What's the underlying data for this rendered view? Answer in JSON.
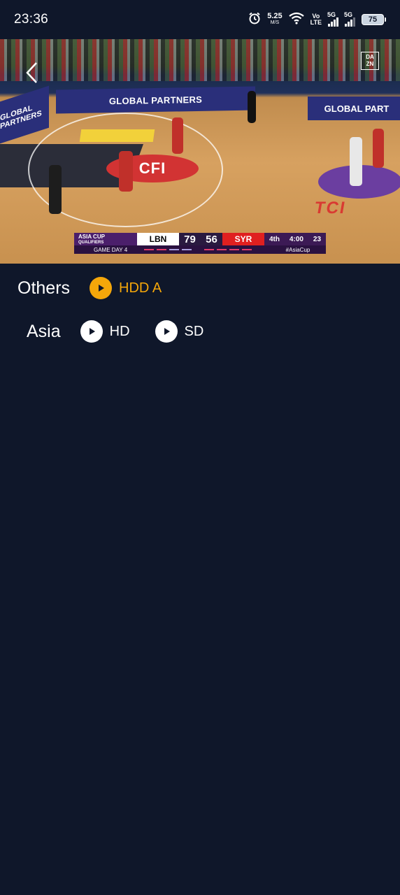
{
  "status_bar": {
    "time": "23:36",
    "net_speed_value": "5.25",
    "net_speed_unit": "M/S",
    "volte_top": "Vo",
    "volte_bottom": "LTE",
    "sim1_label": "5G",
    "sim2_label": "5G",
    "battery_level": "75"
  },
  "video": {
    "broadcaster_logo_line1": "DA",
    "broadcaster_logo_line2": "ZN",
    "ad_board_center": "GLOBAL PARTNERS",
    "ad_board_right": "GLOBAL PART",
    "ad_board_left": "GLOBAL PARTNERS",
    "court_logo": "CFI",
    "court_letters": "TCI",
    "scoreboard": {
      "tournament_line1": "ASIA CUP",
      "tournament_line2": "QUALIFIERS",
      "team1": "LBN",
      "score1": "79",
      "score2": "56",
      "team2": "SYR",
      "period": "4th",
      "clock": "4:00",
      "shot_clock": "23",
      "game_day": "GAME DAY 4",
      "hashtag": "#AsiaCup"
    }
  },
  "streams": [
    {
      "label": "Others",
      "options": [
        {
          "text": "HDD A",
          "active": true
        }
      ]
    },
    {
      "label": "Asia",
      "options": [
        {
          "text": "HD",
          "active": false
        },
        {
          "text": "SD",
          "active": false
        }
      ]
    }
  ],
  "colors": {
    "background": "#0f172a",
    "active": "#f5a70a",
    "inactive": "#ffffff"
  }
}
